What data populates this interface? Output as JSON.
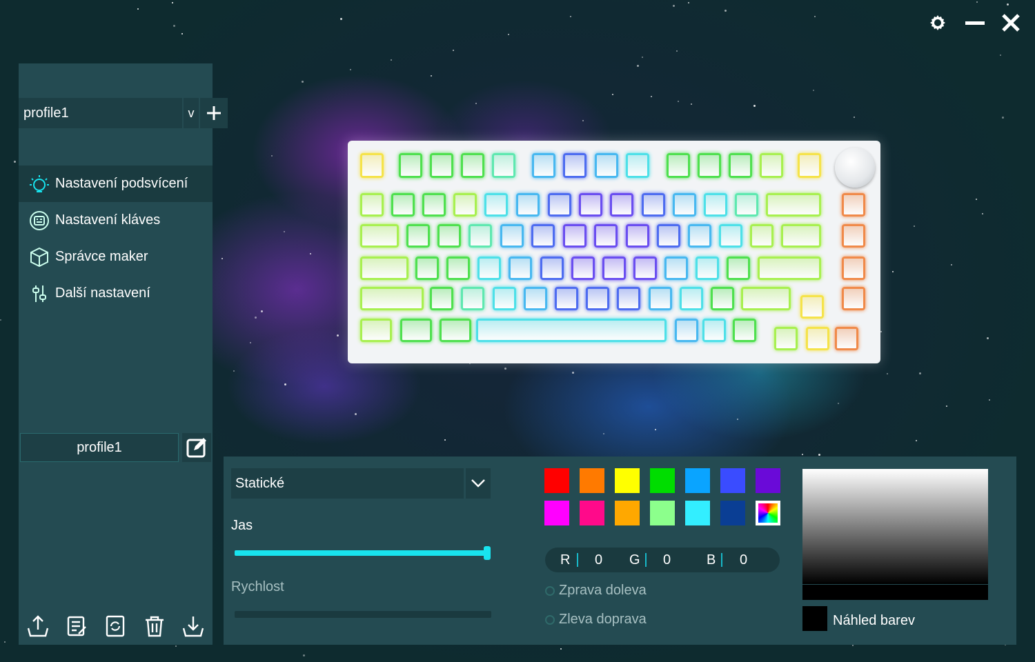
{
  "window": {
    "controls": [
      "gear-icon",
      "minimize-icon",
      "close-icon"
    ]
  },
  "sidebar": {
    "profile_selected": "profile1",
    "profile_dropdown_glyph": "v",
    "nav": [
      {
        "label": "Nastavení podsvícení",
        "icon": "lightbulb-icon",
        "active": true
      },
      {
        "label": "Nastavení kláves",
        "icon": "keyboard-icon",
        "active": false
      },
      {
        "label": "Správce maker",
        "icon": "cube-icon",
        "active": false
      },
      {
        "label": "Další nastavení",
        "icon": "sliders-icon",
        "active": false
      }
    ],
    "profile_name": "profile1",
    "toolbar": [
      "import-icon",
      "notes-icon",
      "reset-icon",
      "trash-icon",
      "export-icon"
    ]
  },
  "keyboard": {
    "key_colors": {
      "yellow": "#f5e34a",
      "green": "#4fe04f",
      "mint": "#5fe8b0",
      "cyan": "#4ee0e8",
      "sky": "#48b8f0",
      "blue": "#4e6cf0",
      "indigo": "#6a4ef0",
      "orange": "#f08a4a",
      "lime": "#a8f050"
    }
  },
  "lighting": {
    "mode": "Statické",
    "brightness_label": "Jas",
    "brightness": 1.0,
    "speed_label": "Rychlost",
    "speed": 0,
    "swatches": [
      "#ff0000",
      "#ff7a00",
      "#ffff00",
      "#00dd00",
      "#0aa4ff",
      "#3a4cff",
      "#6a0ad8",
      "#ff00ff",
      "#ff0a8a",
      "#ffa800",
      "#8cff8c",
      "#33eeff",
      "#0a3e94",
      "rainbow"
    ],
    "rgb": {
      "r_label": "R",
      "r": "0",
      "g_label": "G",
      "g": "0",
      "b_label": "B",
      "b": "0"
    },
    "direction_right_left": "Zprava doleva",
    "direction_left_right": "Zleva doprava",
    "preview_label": "Náhled barev",
    "preview_color": "#000000"
  }
}
